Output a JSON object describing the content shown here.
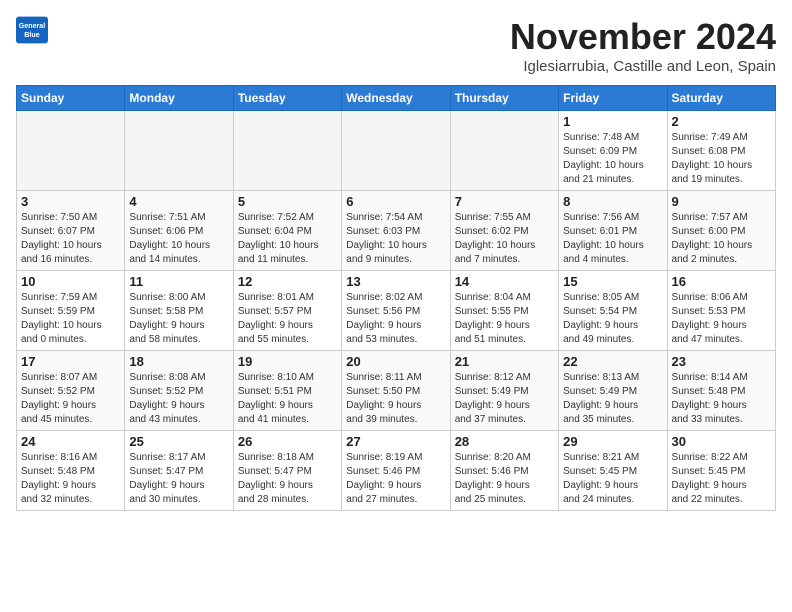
{
  "header": {
    "logo_line1": "General",
    "logo_line2": "Blue",
    "month": "November 2024",
    "location": "Iglesiarrubia, Castille and Leon, Spain"
  },
  "weekdays": [
    "Sunday",
    "Monday",
    "Tuesday",
    "Wednesday",
    "Thursday",
    "Friday",
    "Saturday"
  ],
  "weeks": [
    [
      {
        "day": "",
        "info": ""
      },
      {
        "day": "",
        "info": ""
      },
      {
        "day": "",
        "info": ""
      },
      {
        "day": "",
        "info": ""
      },
      {
        "day": "",
        "info": ""
      },
      {
        "day": "1",
        "info": "Sunrise: 7:48 AM\nSunset: 6:09 PM\nDaylight: 10 hours\nand 21 minutes."
      },
      {
        "day": "2",
        "info": "Sunrise: 7:49 AM\nSunset: 6:08 PM\nDaylight: 10 hours\nand 19 minutes."
      }
    ],
    [
      {
        "day": "3",
        "info": "Sunrise: 7:50 AM\nSunset: 6:07 PM\nDaylight: 10 hours\nand 16 minutes."
      },
      {
        "day": "4",
        "info": "Sunrise: 7:51 AM\nSunset: 6:06 PM\nDaylight: 10 hours\nand 14 minutes."
      },
      {
        "day": "5",
        "info": "Sunrise: 7:52 AM\nSunset: 6:04 PM\nDaylight: 10 hours\nand 11 minutes."
      },
      {
        "day": "6",
        "info": "Sunrise: 7:54 AM\nSunset: 6:03 PM\nDaylight: 10 hours\nand 9 minutes."
      },
      {
        "day": "7",
        "info": "Sunrise: 7:55 AM\nSunset: 6:02 PM\nDaylight: 10 hours\nand 7 minutes."
      },
      {
        "day": "8",
        "info": "Sunrise: 7:56 AM\nSunset: 6:01 PM\nDaylight: 10 hours\nand 4 minutes."
      },
      {
        "day": "9",
        "info": "Sunrise: 7:57 AM\nSunset: 6:00 PM\nDaylight: 10 hours\nand 2 minutes."
      }
    ],
    [
      {
        "day": "10",
        "info": "Sunrise: 7:59 AM\nSunset: 5:59 PM\nDaylight: 10 hours\nand 0 minutes."
      },
      {
        "day": "11",
        "info": "Sunrise: 8:00 AM\nSunset: 5:58 PM\nDaylight: 9 hours\nand 58 minutes."
      },
      {
        "day": "12",
        "info": "Sunrise: 8:01 AM\nSunset: 5:57 PM\nDaylight: 9 hours\nand 55 minutes."
      },
      {
        "day": "13",
        "info": "Sunrise: 8:02 AM\nSunset: 5:56 PM\nDaylight: 9 hours\nand 53 minutes."
      },
      {
        "day": "14",
        "info": "Sunrise: 8:04 AM\nSunset: 5:55 PM\nDaylight: 9 hours\nand 51 minutes."
      },
      {
        "day": "15",
        "info": "Sunrise: 8:05 AM\nSunset: 5:54 PM\nDaylight: 9 hours\nand 49 minutes."
      },
      {
        "day": "16",
        "info": "Sunrise: 8:06 AM\nSunset: 5:53 PM\nDaylight: 9 hours\nand 47 minutes."
      }
    ],
    [
      {
        "day": "17",
        "info": "Sunrise: 8:07 AM\nSunset: 5:52 PM\nDaylight: 9 hours\nand 45 minutes."
      },
      {
        "day": "18",
        "info": "Sunrise: 8:08 AM\nSunset: 5:52 PM\nDaylight: 9 hours\nand 43 minutes."
      },
      {
        "day": "19",
        "info": "Sunrise: 8:10 AM\nSunset: 5:51 PM\nDaylight: 9 hours\nand 41 minutes."
      },
      {
        "day": "20",
        "info": "Sunrise: 8:11 AM\nSunset: 5:50 PM\nDaylight: 9 hours\nand 39 minutes."
      },
      {
        "day": "21",
        "info": "Sunrise: 8:12 AM\nSunset: 5:49 PM\nDaylight: 9 hours\nand 37 minutes."
      },
      {
        "day": "22",
        "info": "Sunrise: 8:13 AM\nSunset: 5:49 PM\nDaylight: 9 hours\nand 35 minutes."
      },
      {
        "day": "23",
        "info": "Sunrise: 8:14 AM\nSunset: 5:48 PM\nDaylight: 9 hours\nand 33 minutes."
      }
    ],
    [
      {
        "day": "24",
        "info": "Sunrise: 8:16 AM\nSunset: 5:48 PM\nDaylight: 9 hours\nand 32 minutes."
      },
      {
        "day": "25",
        "info": "Sunrise: 8:17 AM\nSunset: 5:47 PM\nDaylight: 9 hours\nand 30 minutes."
      },
      {
        "day": "26",
        "info": "Sunrise: 8:18 AM\nSunset: 5:47 PM\nDaylight: 9 hours\nand 28 minutes."
      },
      {
        "day": "27",
        "info": "Sunrise: 8:19 AM\nSunset: 5:46 PM\nDaylight: 9 hours\nand 27 minutes."
      },
      {
        "day": "28",
        "info": "Sunrise: 8:20 AM\nSunset: 5:46 PM\nDaylight: 9 hours\nand 25 minutes."
      },
      {
        "day": "29",
        "info": "Sunrise: 8:21 AM\nSunset: 5:45 PM\nDaylight: 9 hours\nand 24 minutes."
      },
      {
        "day": "30",
        "info": "Sunrise: 8:22 AM\nSunset: 5:45 PM\nDaylight: 9 hours\nand 22 minutes."
      }
    ]
  ]
}
